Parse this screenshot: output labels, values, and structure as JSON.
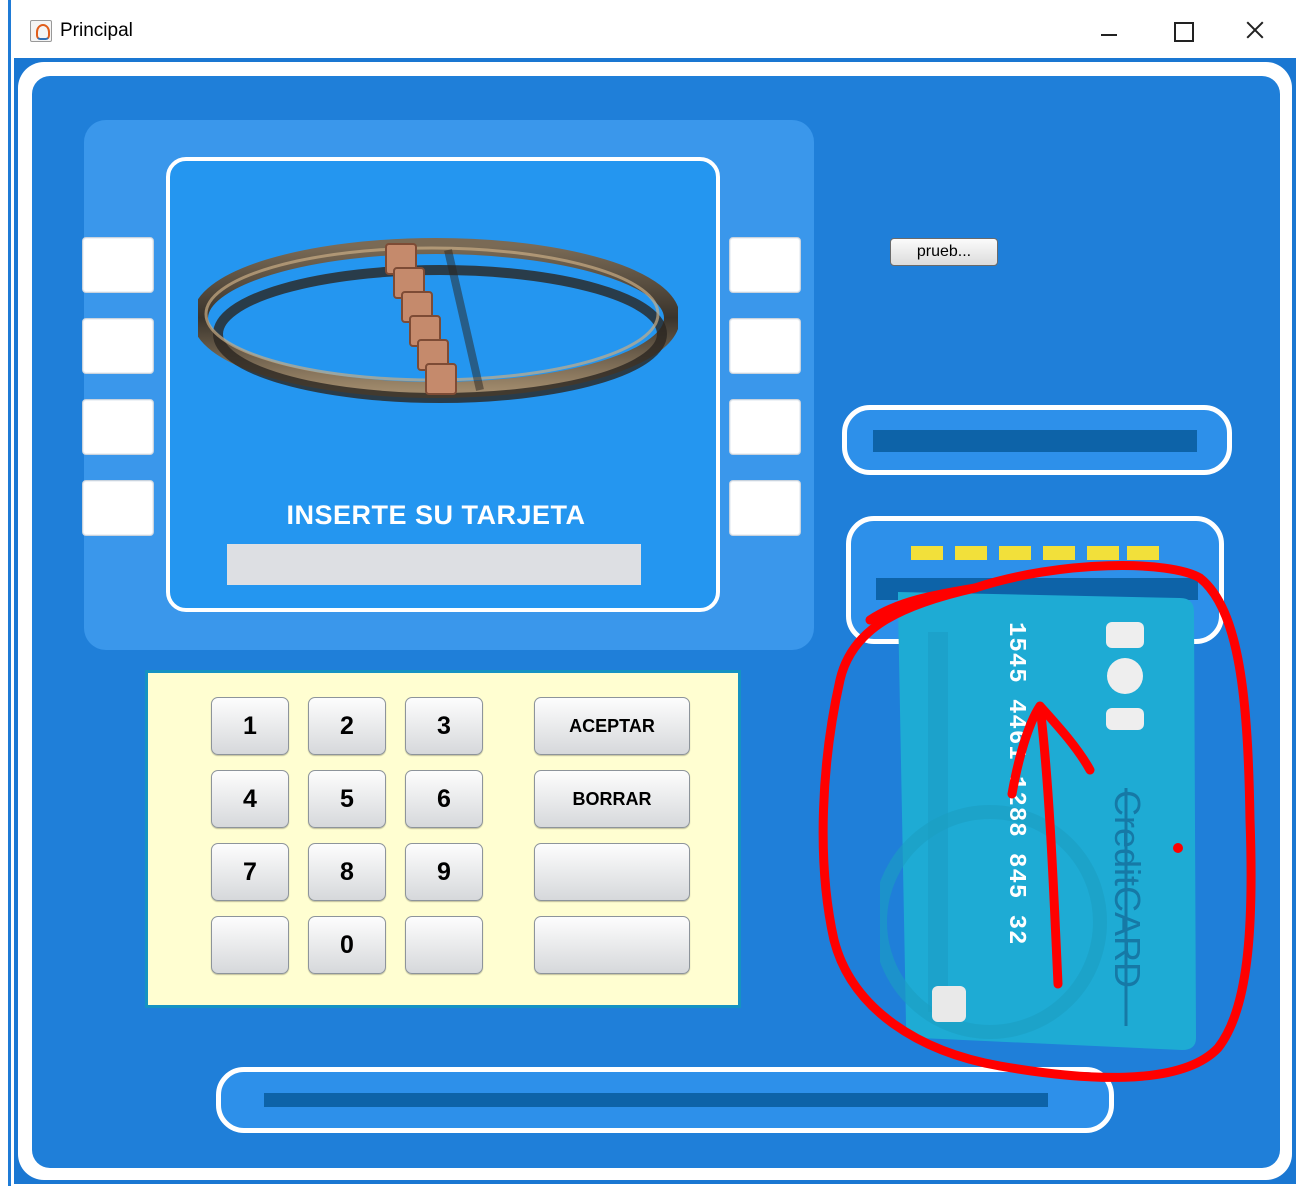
{
  "window": {
    "title": "Principal"
  },
  "screen": {
    "prompt": "INSERTE SU TARJETA",
    "input_value": ""
  },
  "side_buttons": {
    "left": [
      "",
      "",
      "",
      ""
    ],
    "right": [
      "",
      "",
      "",
      ""
    ]
  },
  "test_button": {
    "label": "prueb..."
  },
  "keypad": {
    "digits": [
      "1",
      "2",
      "3",
      "4",
      "5",
      "6",
      "7",
      "8",
      "9",
      "",
      "0",
      ""
    ],
    "actions": [
      "ACEPTAR",
      "BORRAR",
      "",
      ""
    ]
  },
  "card": {
    "number": "1545 4461 1288 845 32",
    "brand": "CreditCARD"
  },
  "colors": {
    "atm_body": "#1f7fd9",
    "screen": "#2496f0",
    "keypad_bg": "#fffed1",
    "card": "#1eabd4",
    "annotation": "#ff0000"
  },
  "icons": [
    "app-icon",
    "minimize-icon",
    "maximize-icon",
    "close-icon",
    "bank-logo-icon",
    "credit-card-icon",
    "annotation-circle-icon",
    "annotation-arrow-icon"
  ]
}
